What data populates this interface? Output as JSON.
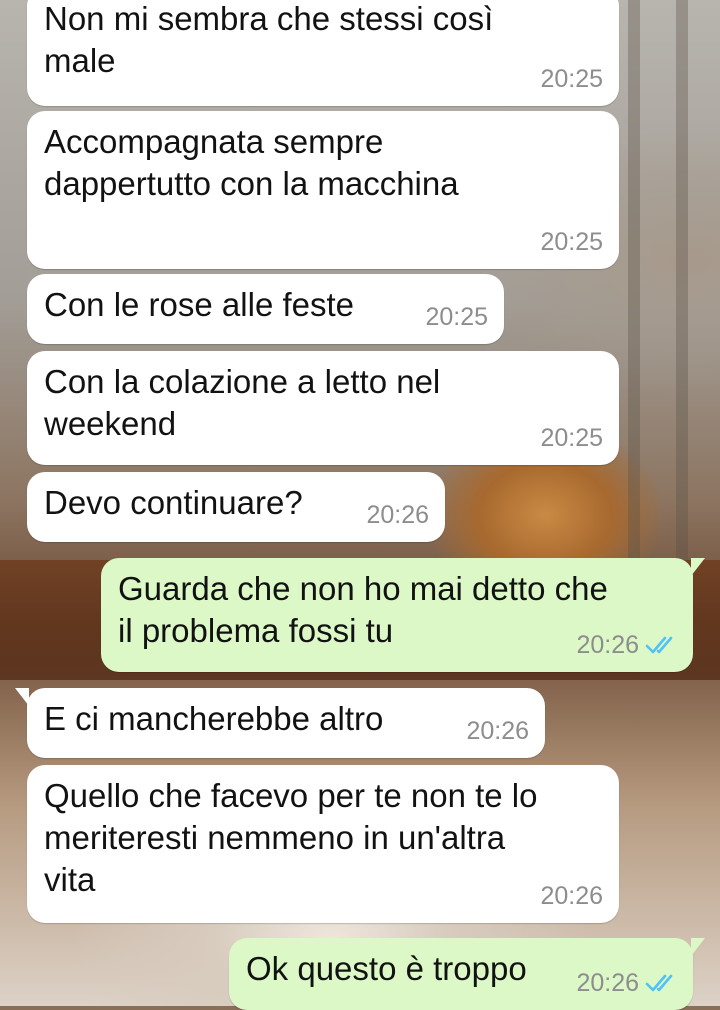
{
  "chat": {
    "messages": [
      {
        "text": "Non mi sembra che stessi così male",
        "line1": "Non mi sembra che stessi così",
        "line2": "male",
        "time": "20:25",
        "direction": "incoming"
      },
      {
        "text": "Accompagnata sempre dappertutto con la macchina",
        "line1": "Accompagnata sempre",
        "line2": "dappertutto con la macchina",
        "time": "20:25",
        "direction": "incoming"
      },
      {
        "text": "Con le rose alle feste",
        "line1": "Con le rose alle feste",
        "time": "20:25",
        "direction": "incoming"
      },
      {
        "text": "Con la colazione a letto nel weekend",
        "line1": "Con la colazione a letto nel",
        "line2": "weekend",
        "time": "20:25",
        "direction": "incoming"
      },
      {
        "text": "Devo continuare?",
        "line1": "Devo continuare?",
        "time": "20:26",
        "direction": "incoming"
      },
      {
        "text": "Guarda che non ho mai detto che il problema fossi tu",
        "line1": "Guarda che non ho mai detto che",
        "line2": "il problema fossi tu",
        "time": "20:26",
        "direction": "outgoing",
        "status": "read"
      },
      {
        "text": "E ci mancherebbe altro",
        "line1": "E ci mancherebbe altro",
        "time": "20:26",
        "direction": "incoming"
      },
      {
        "text": "Quello che facevo per te non te lo meriteresti nemmeno in un'altra vita",
        "line1": "Quello che facevo per te non te lo",
        "line2": "meriteresti nemmeno in un'altra",
        "line3": "vita",
        "time": "20:26",
        "direction": "incoming"
      },
      {
        "text": "Ok questo è troppo",
        "line1": "Ok questo è troppo",
        "time": "20:26",
        "direction": "outgoing",
        "status": "read"
      }
    ]
  },
  "colors": {
    "incoming_bubble": "#ffffff",
    "outgoing_bubble": "#dcf8c6",
    "timestamp": "#8d8d8d",
    "read_ticks": "#4fc3f7",
    "text": "#121212"
  },
  "icons": {
    "read_receipt": "double-check-icon"
  }
}
